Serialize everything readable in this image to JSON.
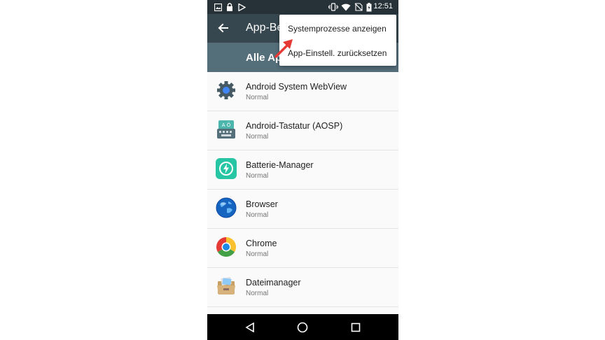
{
  "status_bar": {
    "time": "12:51",
    "icons": [
      "image-icon",
      "lock-icon",
      "play-store-icon",
      "vibrate-icon",
      "wifi-icon",
      "no-sim-icon",
      "battery-charging-icon"
    ]
  },
  "app_bar": {
    "title": "App-Be",
    "back_icon": "arrow-back-icon"
  },
  "sub_bar": {
    "title": "Alle Ap"
  },
  "menu": {
    "items": [
      "Systemprozesse anzeigen",
      "App-Einstell. zurücksetzen"
    ]
  },
  "apps": [
    {
      "name": "Android System WebView",
      "status": "Normal",
      "icon": "gear-icon"
    },
    {
      "name": "Android-Tastatur (AOSP)",
      "status": "Normal",
      "icon": "keyboard-icon"
    },
    {
      "name": "Batterie-Manager",
      "status": "Normal",
      "icon": "battery-manager-icon"
    },
    {
      "name": "Browser",
      "status": "Normal",
      "icon": "globe-icon"
    },
    {
      "name": "Chrome",
      "status": "Normal",
      "icon": "chrome-icon"
    },
    {
      "name": "Dateimanager",
      "status": "Normal",
      "icon": "file-manager-icon"
    }
  ],
  "annotation": {
    "color": "#e53935"
  },
  "colors": {
    "status_bar": "#263238",
    "app_bar": "#37474f",
    "sub_bar": "#546e7a",
    "nav_bar": "#000000"
  }
}
